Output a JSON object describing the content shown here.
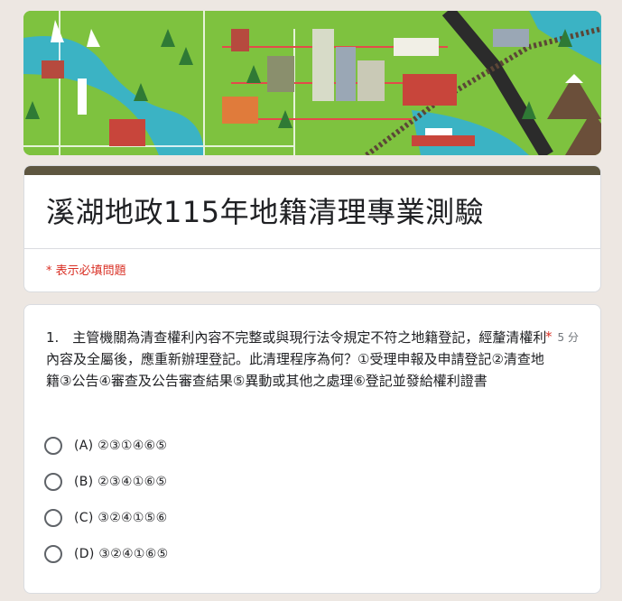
{
  "header": {
    "title": "溪湖地政115年地籍清理專業測驗",
    "required_note": "* 表示必填問題"
  },
  "question": {
    "number": "1.",
    "text": "1.　主管機關為清查權利內容不完整或與現行法令規定不符之地籍登記，經釐清權利內容及全屬後，應重新辦理登記。此清理程序為何？①受理申報及申請登記②清查地籍③公告④審查及公告審查結果⑤異動或其他之處理⑥登記並發給權利證書",
    "required_mark": "*",
    "points": "5 分",
    "options": [
      {
        "label": "(A) ②③①④⑥⑤"
      },
      {
        "label": "(B) ②③④①⑥⑤"
      },
      {
        "label": "(C) ③②④①⑤⑥"
      },
      {
        "label": "(D) ③②④①⑥⑤"
      }
    ]
  },
  "colors": {
    "theme_bar": "#5e5640",
    "required": "#d93025",
    "page_bg": "#ede7e2"
  },
  "banner": {
    "icon": "city-map-illustration"
  }
}
